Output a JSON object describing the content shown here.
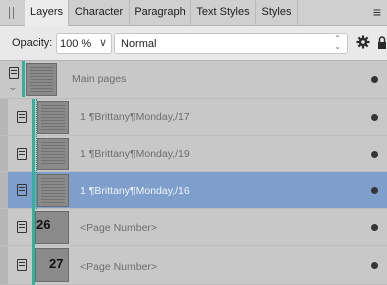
{
  "tabs": [
    {
      "label": "Layers",
      "active": true
    },
    {
      "label": "Character",
      "active": false
    },
    {
      "label": "Paragraph",
      "active": false
    },
    {
      "label": "Text Styles",
      "active": false
    },
    {
      "label": "Styles",
      "active": false
    }
  ],
  "menu_icon": "hamburger-menu-icon",
  "opacity": {
    "label": "Opacity:",
    "value": "100 %"
  },
  "blend_mode": {
    "value": "Normal"
  },
  "icons": {
    "gear": "gear-icon",
    "lock": "lock-icon"
  },
  "colors": {
    "accent_guide": "#2fb39a",
    "selection": "#7e9fcc"
  },
  "layers": [
    {
      "name": "Main pages",
      "selected": false
    },
    {
      "name": "1  ¶Brittany¶Monday,/17",
      "selected": false
    },
    {
      "name": "1  ¶Brittany¶Monday,/19",
      "selected": false
    },
    {
      "name": "1  ¶Brittany¶Monday,/16",
      "selected": true
    },
    {
      "name": "<Page Number>",
      "selected": false,
      "page_num": "26"
    },
    {
      "name": "<Page Number>",
      "selected": false,
      "page_num": "27"
    }
  ]
}
